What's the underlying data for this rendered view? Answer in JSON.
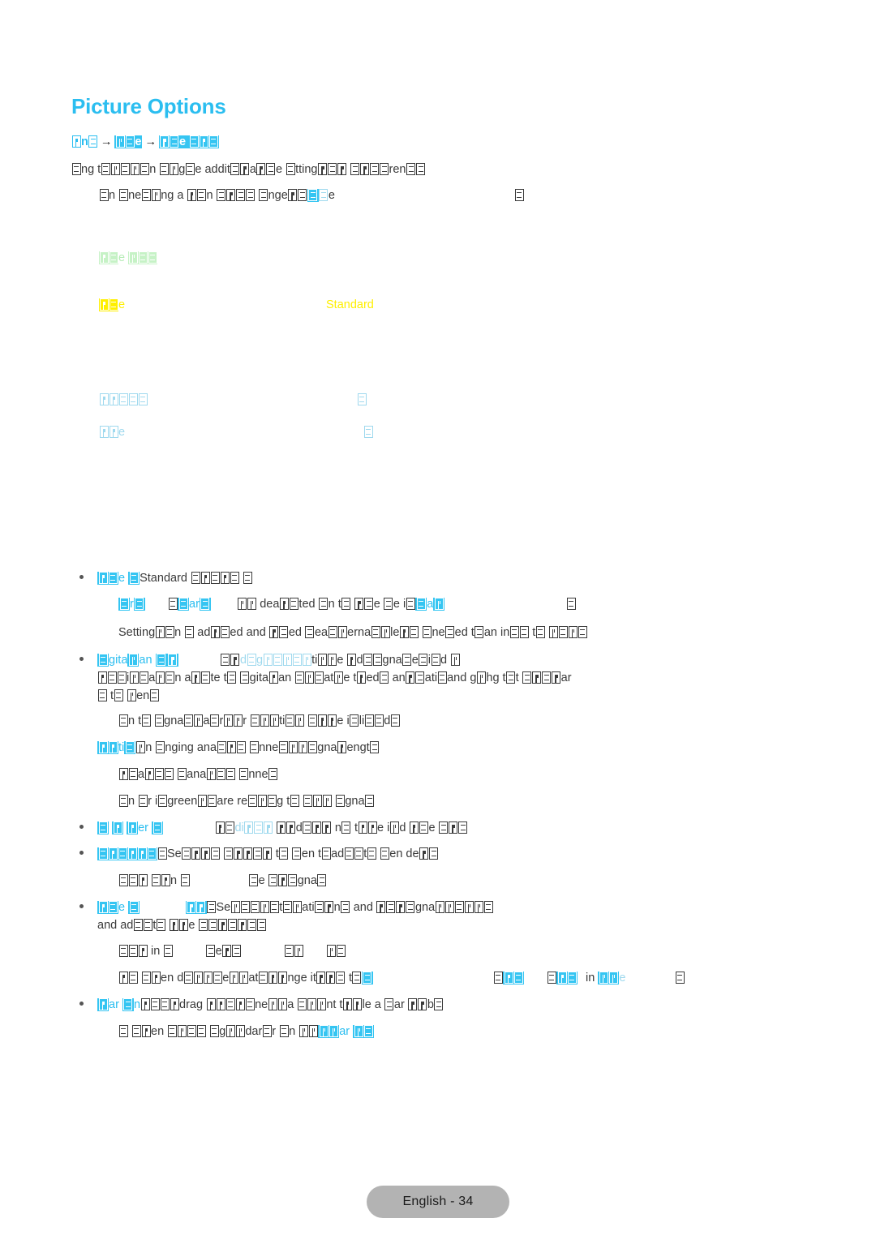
{
  "document": {
    "title": "Picture Options",
    "title_color": "#2bbef0",
    "page_footer": "English - 34"
  },
  "breadcrumb": {
    "segments": [
      "☒n☒",
      "☒☒e",
      "☒☒e ☒☒☒"
    ],
    "separator": "→",
    "note": "breadcrumb glyphs render as missing-glyph boxes"
  },
  "intro": {
    "line1": "☒ng t☒☒☒☒☒n ☒☒g☒e addit☒☒a☒☒☒e ☒tting☒☒☒ ☒☒☒☒ren☒☒",
    "line2": "☒n ☒ne☒☒ng a ☒☒☒n ☒☒☒☒ ☒nge☒☒☒☒e",
    "line2_trailing_box": "☒"
  },
  "menu_panel": {
    "green_row": "☒☒e ☒☒☒",
    "yellow_row_label": "☒☒e",
    "yellow_row_value": "Standard",
    "blue_rows": [
      {
        "label": "☒☒☒☒☒",
        "value": "☒"
      },
      {
        "label": "☒☒e",
        "value": "☒"
      }
    ]
  },
  "bullets": [
    {
      "id": "picture-size-standard",
      "head": "☒☒e ☒",
      "head_plain": "Standard",
      "head_tail": "☒☒☒☒☒ ☒",
      "subs": [
        {
          "text": "☒r☒      ☒☒ar☒      ☒☒ dea☒☒ted ☒n t☒ ☒☒e ☒e i☒☒a☒☒",
          "trailing": "☒"
        },
        {
          "text": "Setting☒☒n ☒ ad☒☒ed and ☒☒ed ☒ea☒☒☒erna☒☒le☒☒ ☒ne☒ed t☒an in☒☒ t☒ ☒☒☒☒"
        }
      ]
    },
    {
      "id": "digital-clean-view",
      "head": "☒gita☒☒an ☒☒☒☒",
      "head_tail": "☒☒☒d☒☒g ☒☒☒☒☒☒ti☒☒☒e ☒☒d☒☒☒gna☒☒e☒i☒d ☒☒",
      "line2": "☒☒☒i☒☒a☒☒n a☒☒te t☒ ☒gita☒☒an ☒☒☒at☒e t☒ed☒ an☒☒ati☒and g☒☒g t☒t ☒☒☒☒ar",
      "line3": "☒ t☒ ☒☒en☒",
      "subs": [
        {
          "text": "☒n t☒ ☒gna☒☒☒a☒r☒☒r ☒☒☒ti☒☒ ☒☒☒☒e i☒☒i☒☒d☒"
        }
      ],
      "extra_line": "☒☒☒☒ti☒☒n ☒nging ana☒☒☒ ☒nne☒☒☒☒☒gna☒☒engt☒",
      "extra_subs": [
        {
          "text": "☒☒☒a☒☒☒ ☒ana☒☒☒ ☒nne☒"
        },
        {
          "text": "☒n ☒r i☒green☒☒are re☒☒i☒g t☒ ☒☒☒☒ ☒gna☒"
        }
      ]
    },
    {
      "id": "mpeg-noise-filter",
      "head": "☒☒ ☒☒ ☒☒er ☒",
      "head_tail": "☒☒☒di☒☒☒ ☒☒☒☒d☒☒☒☒ n☒☒ t☒☒☒e i☒☒d ☒☒e ☒☒☒☒"
    },
    {
      "id": "hdmi-black-level",
      "head": "☒☒☒☒☒☒☒☒☒",
      "head_plain": "Se☒☒☒☒ ☒☒☒☒☒☒ t☒ ☒☒en t☒ad☒☒t☒ ☒☒en de☒☒",
      "subs": [
        {
          "text": "☒☒☒☒ ☒☒n ☒              ☒e ☒☒☒gna☒"
        }
      ]
    },
    {
      "id": "auto-motion-plus",
      "head": "☒☒☒e ☒",
      "head_tail": "☒☒☒☒☒Se☒☒☒ ☒☒☒☒t☒☒☒ati☒☒☒n☒ and ☒☒☒☒gna☒☒☒☒☒☒☒☒",
      "line2": "and ad☒☒t☒ ☒☒e ☒☒☒☒☒☒☒",
      "subs": [
        {
          "text": "☒☒☒ in ☒         ☒e☒☒          ☒☒       ☒☒"
        },
        {
          "text": "☒☒ ☒☒en d☒☒☒☒☒e☒☒at☒☒☒☒nge it☒☒☒ t☒☒",
          "right_items": [
            "☒☒☒",
            "☒☒☒",
            "in ☒☒☒e",
            "☒"
          ]
        }
      ]
    },
    {
      "id": "film-mode",
      "head": "☒☒ar ☒☒☒☒☒☒",
      "head_tail": "drag ☒☒☒☒☒ne☒☒a ☒☒☒☒nt t☒☒☒le a ☒ar ☒☒☒b☒",
      "subs": [
        {
          "text": "☒ ☒☒en ☒☒☒☒ ☒☒☒☒dar☒r ☒n ☒☒☒☒ar ☒☒☒"
        }
      ]
    }
  ],
  "colors": {
    "accent_cyan": "#2bbef0",
    "light_cyan": "#9fd9ee",
    "green": "#b6ecb6",
    "yellow": "#ffef00",
    "body_text": "#3a3a3a",
    "footer_bg": "#b3b3b3"
  }
}
